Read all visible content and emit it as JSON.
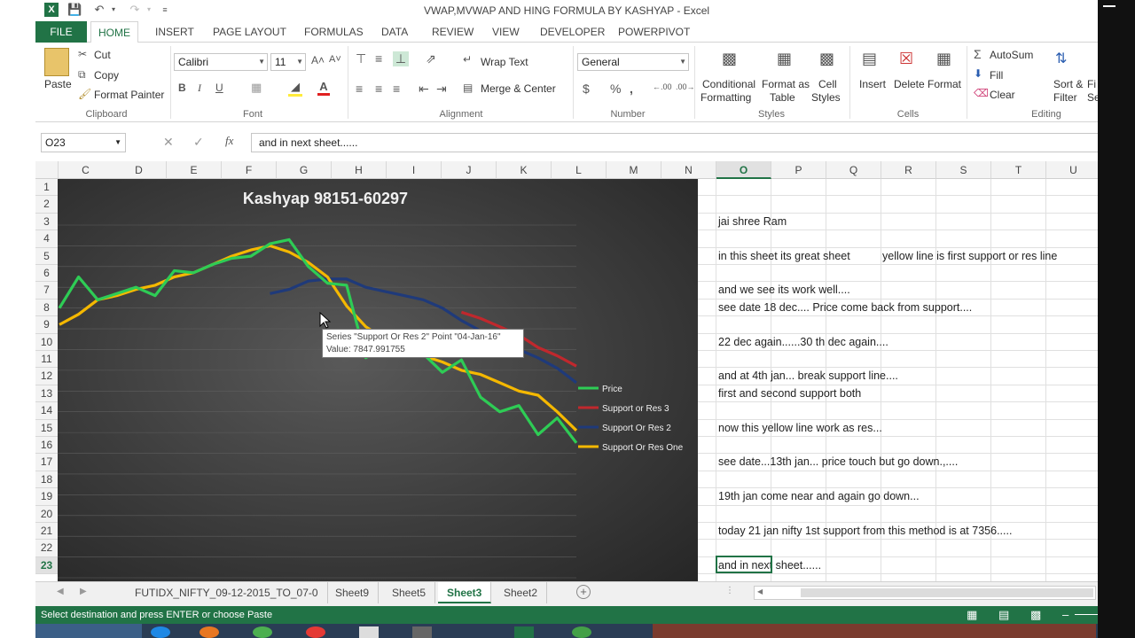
{
  "window": {
    "title": "VWAP,MVWAP AND HING FORMULA BY  KASHYAP - Excel"
  },
  "ribbon_tabs": [
    "FILE",
    "HOME",
    "INSERT",
    "PAGE LAYOUT",
    "FORMULAS",
    "DATA",
    "REVIEW",
    "VIEW",
    "DEVELOPER",
    "POWERPIVOT"
  ],
  "ribbon": {
    "clipboard": {
      "paste": "Paste",
      "cut": "Cut",
      "copy": "Copy",
      "format_painter": "Format Painter",
      "label": "Clipboard"
    },
    "font": {
      "name": "Calibri",
      "size": "11",
      "label": "Font"
    },
    "alignment": {
      "wrap_text": "Wrap Text",
      "merge_center": "Merge & Center",
      "label": "Alignment"
    },
    "number": {
      "format": "General",
      "label": "Number"
    },
    "styles": {
      "conditional": "Conditional",
      "formatting": "Formatting",
      "format_as": "Format as",
      "table": "Table",
      "cell": "Cell",
      "styles_word": "Styles",
      "label": "Styles"
    },
    "cells": {
      "insert": "Insert",
      "delete": "Delete",
      "format": "Format",
      "label": "Cells"
    },
    "editing": {
      "autosum": "AutoSum",
      "fill": "Fill",
      "clear": "Clear",
      "sort": "Sort &",
      "filter": "Filter",
      "find": "Fi",
      "find2": "Se",
      "label": "Editing"
    }
  },
  "formula_bar": {
    "name_box": "O23",
    "content": "and in next sheet......"
  },
  "columns": [
    "C",
    "D",
    "E",
    "F",
    "G",
    "H",
    "I",
    "J",
    "K",
    "L",
    "M",
    "N",
    "O",
    "P",
    "Q",
    "R",
    "S",
    "T",
    "U"
  ],
  "rows": [
    "1",
    "2",
    "3",
    "4",
    "5",
    "6",
    "7",
    "8",
    "9",
    "10",
    "11",
    "12",
    "13",
    "14",
    "15",
    "16",
    "17",
    "18",
    "19",
    "20",
    "21",
    "22",
    "23"
  ],
  "cells": [
    {
      "row": 3,
      "text": "jai shree Ram"
    },
    {
      "row": 5,
      "text": "in this sheet its great sheet"
    },
    {
      "row": 5,
      "text": "yellow line is first support or res line"
    },
    {
      "row": 7,
      "text": "and we see its work well...."
    },
    {
      "row": 8,
      "text": "see date 18 dec.... Price come back from support...."
    },
    {
      "row": 10,
      "text": "22 dec again......30 th dec again...."
    },
    {
      "row": 12,
      "text": "and at 4th jan... break support line...."
    },
    {
      "row": 13,
      "text": "first and second support both"
    },
    {
      "row": 15,
      "text": "now this yellow line work as res..."
    },
    {
      "row": 17,
      "text": "see date...13th jan... price touch but go down.,...."
    },
    {
      "row": 19,
      "text": "19th jan come near and again go down..."
    },
    {
      "row": 21,
      "text": "today 21 jan nifty 1st support from this method is at 7356....."
    },
    {
      "row": 23,
      "text": "and in next sheet......"
    }
  ],
  "chart_data": {
    "type": "line",
    "title": "Kashyap 98151-60297",
    "legend_position": "right",
    "series": [
      {
        "name": "Price",
        "color": "#2ecc55",
        "values": [
          10,
          8.5,
          9.6,
          9.3,
          9.0,
          9.4,
          8.2,
          8.3,
          7.9,
          7.6,
          7.5,
          6.9,
          6.7,
          8.0,
          8.8,
          8.9,
          12.4,
          11.8,
          11.9,
          12.2,
          13.1,
          12.5,
          14.3,
          15.0,
          14.7,
          16.1,
          15.3,
          16.5
        ]
      },
      {
        "name": "Support or Res 3",
        "color": "#c0282d",
        "values": [
          null,
          null,
          null,
          null,
          null,
          null,
          null,
          null,
          null,
          null,
          null,
          null,
          null,
          null,
          null,
          null,
          null,
          null,
          null,
          null,
          null,
          10.2,
          10.5,
          10.9,
          11.3,
          11.9,
          12.3,
          12.8
        ]
      },
      {
        "name": "Support Or Res 2",
        "color": "#1f3a7a",
        "values": [
          null,
          null,
          null,
          null,
          null,
          null,
          null,
          null,
          null,
          null,
          null,
          9.3,
          9.1,
          8.7,
          8.6,
          8.6,
          9.0,
          9.2,
          9.4,
          9.6,
          10.0,
          10.6,
          11.1,
          11.5,
          12.0,
          12.4,
          12.9,
          13.6
        ]
      },
      {
        "name": "Support Or Res One",
        "color": "#f5b800",
        "values": [
          10.8,
          10.3,
          9.6,
          9.4,
          9.1,
          8.9,
          8.5,
          8.3,
          7.9,
          7.5,
          7.2,
          7.0,
          7.3,
          7.8,
          8.5,
          9.9,
          10.9,
          11.5,
          11.8,
          12.3,
          12.6,
          13.0,
          13.2,
          13.6,
          14.0,
          14.2,
          15.0,
          15.9
        ]
      }
    ],
    "tooltip": {
      "line1": "Series \"Support Or Res 2\" Point \"04-Jan-16\"",
      "line2": "Value: 7847.991755"
    }
  },
  "sheet_tabs": [
    "FUTIDX_NIFTY_09-12-2015_TO_07-0",
    "Sheet9",
    "Sheet5",
    "Sheet3",
    "Sheet2"
  ],
  "active_sheet": "Sheet3",
  "status_bar": {
    "message": "Select destination and press ENTER or choose Paste"
  }
}
